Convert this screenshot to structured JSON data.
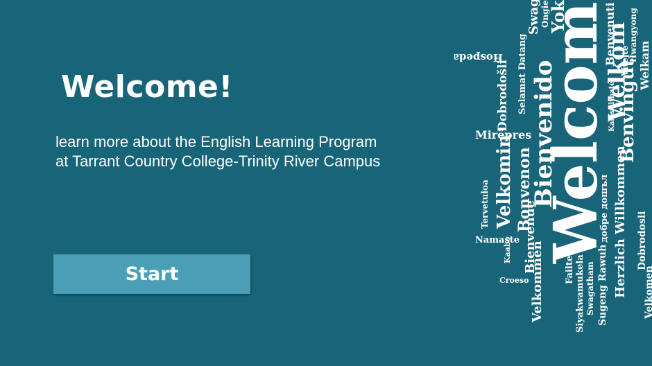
{
  "slide": {
    "title": "Welcome!",
    "subtitle": "learn more about the English Learning Program at Tarrant Country College-Trinity River Campus",
    "start_label": "Start"
  },
  "word_cloud": {
    "words": [
      "Welcome",
      "Bienvenido",
      "Welkom",
      "Velkomin",
      "Bonvenon",
      "Benvingut",
      "Yokoso",
      "Dobrodošli",
      "Hospedar",
      "Mirëpres",
      "Herzlich Willkommen",
      "Bienvenue",
      "Velkommen",
      "Siyakwamukela",
      "Swagatham",
      "Sugeng Rawuh",
      "Namaste",
      "Tervetuloa",
      "Selamat Datang",
      "Failte",
      "Croeso",
      "Hwangyong",
      "Vitejte",
      "добре дошъл",
      "Kaabo",
      "Kalos Ilthate",
      "Velkomen",
      "Dobrodosli",
      "Swagat",
      "Ongietorri",
      "Benvenuti",
      "Welkam"
    ]
  }
}
